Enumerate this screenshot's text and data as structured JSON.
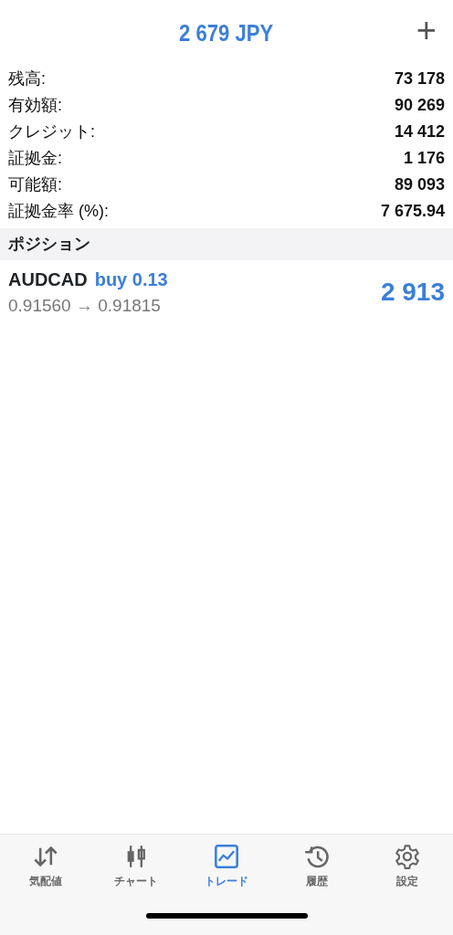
{
  "header": {
    "title": "2 679 JPY",
    "add_symbol": "+"
  },
  "summary": [
    {
      "label": "残高:",
      "value": "73 178"
    },
    {
      "label": "有効額:",
      "value": "90 269"
    },
    {
      "label": "クレジット:",
      "value": "14 412"
    },
    {
      "label": "証拠金:",
      "value": "1 176"
    },
    {
      "label": "可能額:",
      "value": "89 093"
    },
    {
      "label": "証拠金率 (%):",
      "value": "7 675.94"
    }
  ],
  "section_title": "ポジション",
  "positions": [
    {
      "symbol": "AUDCAD",
      "side": "buy 0.13",
      "prices": "0.91560 → 0.91815",
      "profit": "2 913"
    }
  ],
  "tabs": [
    {
      "kind": "quotes",
      "label": "気配値",
      "selected": false
    },
    {
      "kind": "chart",
      "label": "チャート",
      "selected": false
    },
    {
      "kind": "trade",
      "label": "トレード",
      "selected": true
    },
    {
      "kind": "history",
      "label": "履歴",
      "selected": false
    },
    {
      "kind": "settings",
      "label": "設定",
      "selected": false
    }
  ]
}
